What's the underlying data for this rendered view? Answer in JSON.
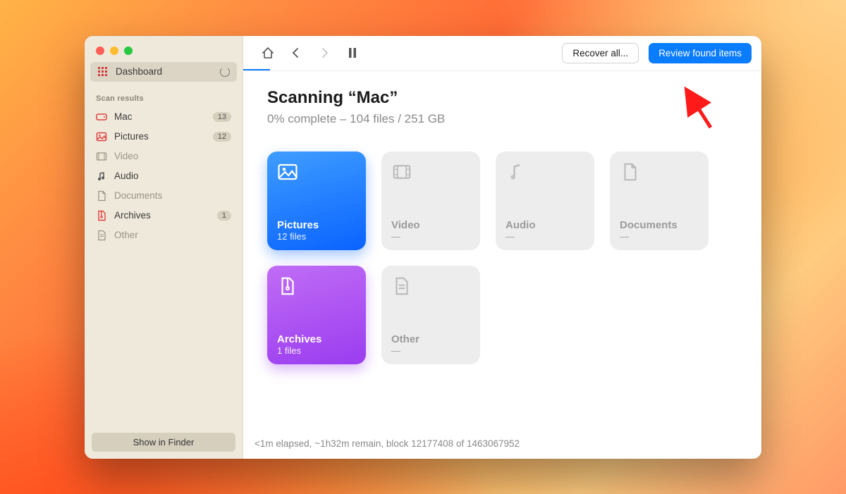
{
  "sidebar": {
    "dashboard_label": "Dashboard",
    "section_label": "Scan results",
    "items": [
      {
        "label": "Mac",
        "badge": "13",
        "icon": "disk-icon",
        "color": "#e04040",
        "muted": false
      },
      {
        "label": "Pictures",
        "badge": "12",
        "icon": "picture-icon",
        "color": "#e04040",
        "muted": false
      },
      {
        "label": "Video",
        "badge": "",
        "icon": "video-icon",
        "color": "#9a9484",
        "muted": true
      },
      {
        "label": "Audio",
        "badge": "",
        "icon": "audio-icon",
        "color": "#555",
        "muted": false
      },
      {
        "label": "Documents",
        "badge": "",
        "icon": "document-icon",
        "color": "#9a9484",
        "muted": true
      },
      {
        "label": "Archives",
        "badge": "1",
        "icon": "archive-icon",
        "color": "#e04040",
        "muted": false
      },
      {
        "label": "Other",
        "badge": "",
        "icon": "other-icon",
        "color": "#9a9484",
        "muted": true
      }
    ],
    "finder_label": "Show in Finder"
  },
  "topbar": {
    "recover_label": "Recover all...",
    "review_label": "Review found items"
  },
  "headline": {
    "title": "Scanning “Mac”",
    "subtitle": "0% complete – 104 files / 251 GB"
  },
  "cards": [
    {
      "title": "Pictures",
      "sub": "12 files",
      "style": "active-blue",
      "icon": "picture"
    },
    {
      "title": "Video",
      "sub": "—",
      "style": "",
      "icon": "video"
    },
    {
      "title": "Audio",
      "sub": "—",
      "style": "",
      "icon": "audio"
    },
    {
      "title": "Documents",
      "sub": "—",
      "style": "",
      "icon": "document"
    },
    {
      "title": "Archives",
      "sub": "1 files",
      "style": "active-purple",
      "icon": "archive"
    },
    {
      "title": "Other",
      "sub": "—",
      "style": "",
      "icon": "other"
    }
  ],
  "status": "<1m elapsed, ~1h32m remain, block 12177408 of 1463067952"
}
